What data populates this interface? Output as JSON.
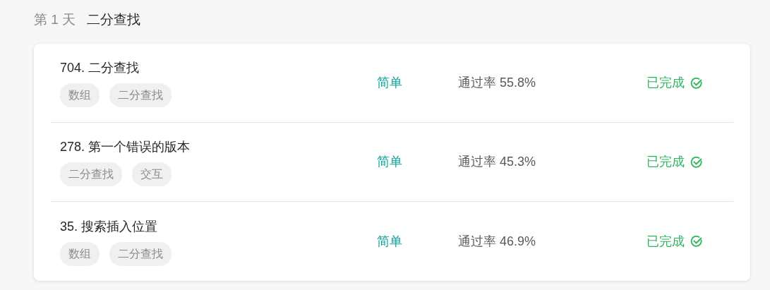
{
  "day": {
    "label": "第 1 天",
    "title": "二分查找"
  },
  "problems": [
    {
      "title": "704. 二分查找",
      "tags": [
        "数组",
        "二分查找"
      ],
      "difficulty": {
        "kind": "easy",
        "label": "简单"
      },
      "pass_rate_label": "通过率",
      "pass_rate": "55.8%",
      "status": {
        "completed": true,
        "label": "已完成"
      }
    },
    {
      "title": "278. 第一个错误的版本",
      "tags": [
        "二分查找",
        "交互"
      ],
      "difficulty": {
        "kind": "easy",
        "label": "简单"
      },
      "pass_rate_label": "通过率",
      "pass_rate": "45.3%",
      "status": {
        "completed": true,
        "label": "已完成"
      }
    },
    {
      "title": "35. 搜索插入位置",
      "tags": [
        "数组",
        "二分查找"
      ],
      "difficulty": {
        "kind": "easy",
        "label": "简单"
      },
      "pass_rate_label": "通过率",
      "pass_rate": "46.9%",
      "status": {
        "completed": true,
        "label": "已完成"
      }
    }
  ]
}
